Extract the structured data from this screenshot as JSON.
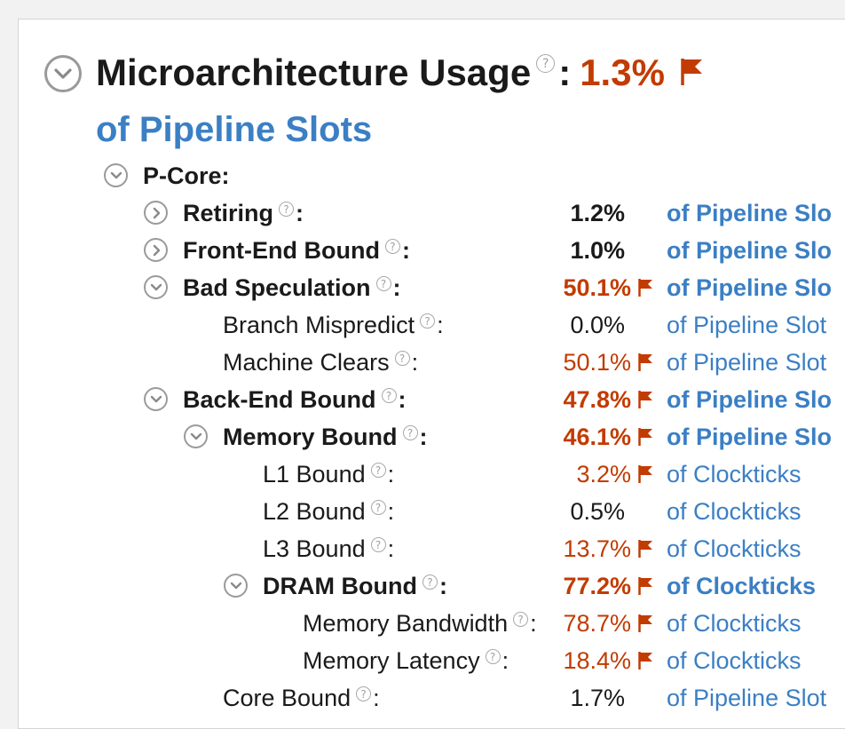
{
  "header": {
    "title": "Microarchitecture Usage",
    "colon": ":",
    "value": "1.3%",
    "subtitle": "of Pipeline Slots",
    "help_glyph": "?"
  },
  "colors": {
    "warning": "#c23b00",
    "link": "#3b7fc4",
    "text": "#1a1a1a"
  },
  "tree": [
    {
      "label": "P-Core:",
      "level": 0,
      "toggle": "expanded",
      "bold": true,
      "help": false,
      "value": "",
      "flag": false,
      "unit": ""
    },
    {
      "label": "Retiring",
      "level": 1,
      "toggle": "collapsed",
      "bold": true,
      "help": true,
      "value": "1.2%",
      "flag": false,
      "unit": "of Pipeline Slo"
    },
    {
      "label": "Front-End Bound",
      "level": 1,
      "toggle": "collapsed",
      "bold": true,
      "help": true,
      "value": "1.0%",
      "flag": false,
      "unit": "of Pipeline Slo"
    },
    {
      "label": "Bad Speculation",
      "level": 1,
      "toggle": "expanded",
      "bold": true,
      "help": true,
      "value": "50.1%",
      "flag": true,
      "unit": "of Pipeline Slo"
    },
    {
      "label": "Branch Mispredict",
      "level": 2,
      "toggle": "none",
      "bold": false,
      "help": true,
      "value": "0.0%",
      "flag": false,
      "unit": "of Pipeline Slot"
    },
    {
      "label": "Machine Clears",
      "level": 2,
      "toggle": "none",
      "bold": false,
      "help": true,
      "value": "50.1%",
      "flag": true,
      "unit": "of Pipeline Slot"
    },
    {
      "label": "Back-End Bound",
      "level": 1,
      "toggle": "expanded",
      "bold": true,
      "help": true,
      "value": "47.8%",
      "flag": true,
      "unit": "of Pipeline Slo"
    },
    {
      "label": "Memory Bound",
      "level": 2,
      "toggle": "expanded",
      "bold": true,
      "help": true,
      "value": "46.1%",
      "flag": true,
      "unit": "of Pipeline Slo"
    },
    {
      "label": "L1 Bound",
      "level": 3,
      "toggle": "none",
      "bold": false,
      "help": true,
      "value": "3.2%",
      "flag": true,
      "unit": "of Clockticks"
    },
    {
      "label": "L2 Bound",
      "level": 3,
      "toggle": "none",
      "bold": false,
      "help": true,
      "value": "0.5%",
      "flag": false,
      "unit": "of Clockticks"
    },
    {
      "label": "L3 Bound",
      "level": 3,
      "toggle": "none",
      "bold": false,
      "help": true,
      "value": "13.7%",
      "flag": true,
      "unit": "of Clockticks"
    },
    {
      "label": "DRAM Bound",
      "level": 3,
      "toggle": "expanded",
      "bold": true,
      "help": true,
      "value": "77.2%",
      "flag": true,
      "unit": "of Clockticks"
    },
    {
      "label": "Memory Bandwidth",
      "level": 4,
      "toggle": "none",
      "bold": false,
      "help": true,
      "value": "78.7%",
      "flag": true,
      "unit": "of Clockticks"
    },
    {
      "label": "Memory Latency",
      "level": 4,
      "toggle": "none",
      "bold": false,
      "help": true,
      "value": "18.4%",
      "flag": true,
      "unit": "of Clockticks"
    },
    {
      "label": "Core Bound",
      "level": 2,
      "toggle": "none",
      "bold": false,
      "help": true,
      "value": "1.7%",
      "flag": false,
      "unit": "of Pipeline Slot"
    }
  ]
}
